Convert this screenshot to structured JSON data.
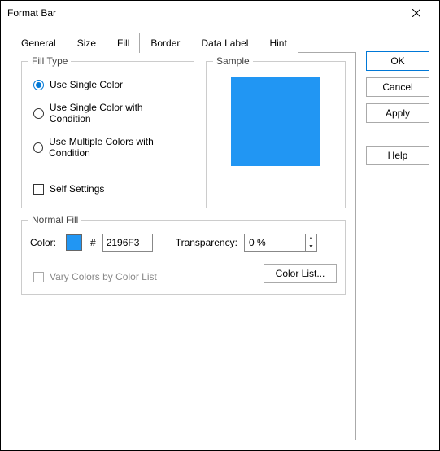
{
  "window": {
    "title": "Format Bar"
  },
  "tabs": [
    "General",
    "Size",
    "Fill",
    "Border",
    "Data Label",
    "Hint"
  ],
  "active_tab": 2,
  "fill_type": {
    "legend": "Fill Type",
    "options": [
      "Use Single Color",
      "Use Single Color with Condition",
      "Use Multiple Colors with Condition"
    ],
    "selected": 0,
    "self_settings_label": "Self Settings",
    "self_settings_checked": false
  },
  "sample": {
    "legend": "Sample",
    "color": "#2196F3"
  },
  "normal_fill": {
    "legend": "Normal Fill",
    "color_label": "Color:",
    "hash": "#",
    "hex_value": "2196F3",
    "swatch_color": "#2196F3",
    "transparency_label": "Transparency:",
    "transparency_value": "0 %",
    "vary_label": "Vary Colors by Color List",
    "vary_enabled": false,
    "color_list_button": "Color List..."
  },
  "buttons": {
    "ok": "OK",
    "cancel": "Cancel",
    "apply": "Apply",
    "help": "Help"
  }
}
